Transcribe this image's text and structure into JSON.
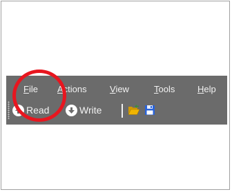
{
  "menu": {
    "file": {
      "mnemonic": "F",
      "rest": "ile"
    },
    "actions": {
      "mnemonic": "A",
      "rest": "ctions"
    },
    "view": {
      "mnemonic": "V",
      "rest": "iew"
    },
    "tools": {
      "mnemonic": "T",
      "rest": "ools"
    },
    "help": {
      "mnemonic": "H",
      "rest": "elp"
    }
  },
  "toolbar": {
    "read_label": "Read",
    "write_label": "Write",
    "read_icon": "arrow-up-circle-icon",
    "write_icon": "arrow-down-circle-icon",
    "open_icon": "open-folder-icon",
    "save_icon": "floppy-disk-icon"
  },
  "colors": {
    "toolbar_bg": "#6b6b6b",
    "highlight": "#e8161f",
    "folder": "#f0b400",
    "floppy": "#2a63d8"
  }
}
